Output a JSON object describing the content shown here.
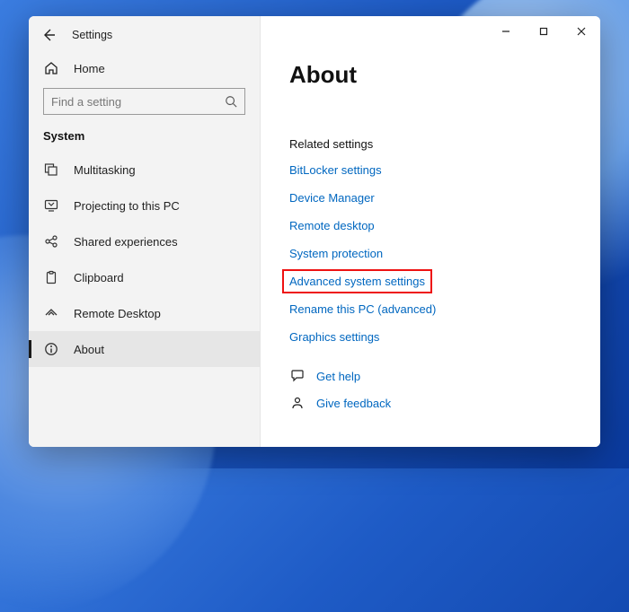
{
  "window": {
    "app_title": "Settings"
  },
  "sidebar": {
    "home_label": "Home",
    "search_placeholder": "Find a setting",
    "section_label": "System",
    "items": [
      {
        "label": "Multitasking"
      },
      {
        "label": "Projecting to this PC"
      },
      {
        "label": "Shared experiences"
      },
      {
        "label": "Clipboard"
      },
      {
        "label": "Remote Desktop"
      },
      {
        "label": "About"
      }
    ]
  },
  "main": {
    "page_title": "About",
    "related_heading": "Related settings",
    "links": [
      {
        "label": "BitLocker settings"
      },
      {
        "label": "Device Manager"
      },
      {
        "label": "Remote desktop"
      },
      {
        "label": "System protection"
      },
      {
        "label": "Advanced system settings",
        "highlighted": true
      },
      {
        "label": "Rename this PC (advanced)"
      },
      {
        "label": "Graphics settings"
      }
    ],
    "help_label": "Get help",
    "feedback_label": "Give feedback"
  }
}
